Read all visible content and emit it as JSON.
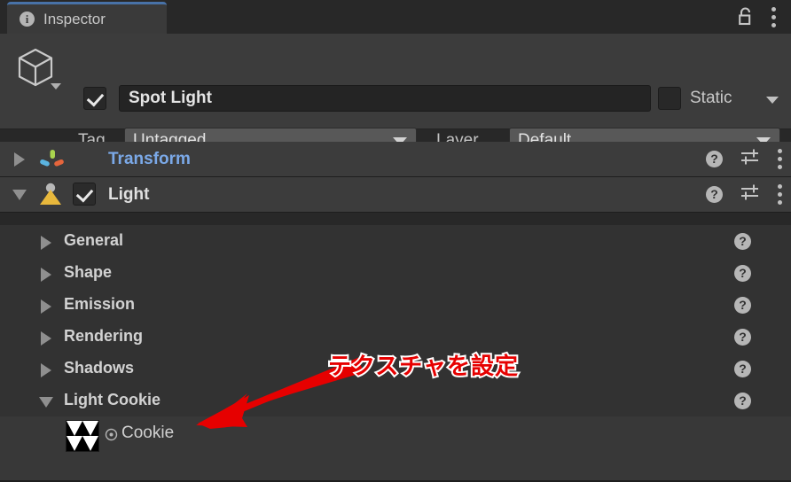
{
  "window": {
    "tab_label": "Inspector",
    "tab_icon": "info-icon",
    "lock_icon": "padlock-open-icon",
    "menu_icon": "kebab-menu-icon"
  },
  "gameobject": {
    "icon": "cube-icon",
    "enabled": true,
    "name": "Spot Light",
    "static_checked": false,
    "static_label": "Static",
    "tag_label": "Tag",
    "tag_value": "Untagged",
    "layer_label": "Layer",
    "layer_value": "Default"
  },
  "components": [
    {
      "name": "Transform",
      "expanded": false,
      "has_enable_checkbox": false,
      "icon": "transform-axis-icon",
      "link_style": true
    },
    {
      "name": "Light",
      "expanded": true,
      "has_enable_checkbox": true,
      "enabled": true,
      "icon": "light-bulb-icon",
      "link_style": false
    }
  ],
  "light_sections": [
    {
      "label": "General",
      "expanded": false,
      "help": "?"
    },
    {
      "label": "Shape",
      "expanded": false,
      "help": "?"
    },
    {
      "label": "Emission",
      "expanded": false,
      "help": "?"
    },
    {
      "label": "Rendering",
      "expanded": false,
      "help": "?"
    },
    {
      "label": "Shadows",
      "expanded": false,
      "help": "?"
    },
    {
      "label": "Light Cookie",
      "expanded": true,
      "help": "?"
    }
  ],
  "cookie_property": {
    "label": "Cookie",
    "thumbnail": "checker-triangle-texture",
    "picker_icon": "object-picker-target-icon"
  },
  "annotation": {
    "text": "テクスチャを設定",
    "arrow": "red-arrow-pointing-down-left",
    "color": "#e60000",
    "outline_color": "#ffffff"
  },
  "colors": {
    "panel_bg": "#3c3c3c",
    "section_bg": "#323232",
    "field_bg": "#242424",
    "dropdown_bg": "#585858",
    "accent_tab": "#4872a8",
    "link_text": "#7ba9e8",
    "light_icon": "#e8b83c"
  }
}
